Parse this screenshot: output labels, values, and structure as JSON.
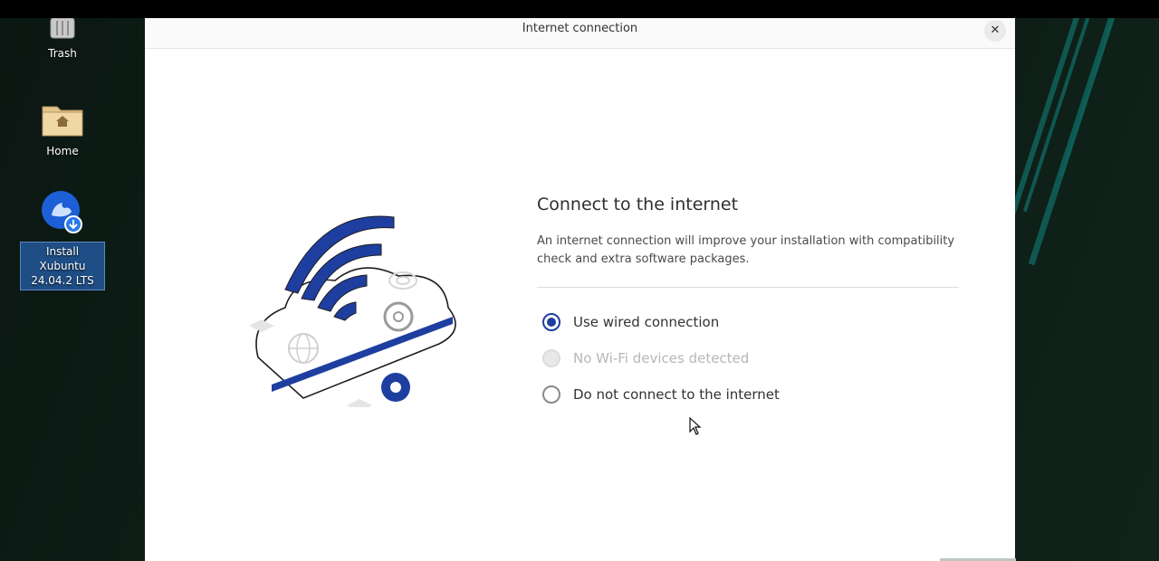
{
  "desktop": {
    "icons": [
      {
        "label": "Trash",
        "icon": "trash-icon"
      },
      {
        "label": "Home",
        "icon": "home-folder-icon"
      },
      {
        "label_line1": "Install Xubuntu",
        "label_line2": "24.04.2 LTS",
        "icon": "installer-icon",
        "selected": true
      }
    ],
    "accent_color": "#0f5e58"
  },
  "window": {
    "title": "Internet connection",
    "close_icon": "close-icon",
    "heading": "Connect to the internet",
    "description": "An internet connection will improve your installation with compatibility check and extra software packages.",
    "options": [
      {
        "label": "Use wired connection",
        "state": "checked"
      },
      {
        "label": "No Wi-Fi devices detected",
        "state": "disabled"
      },
      {
        "label": "Do not connect to the internet",
        "state": "unchecked"
      }
    ],
    "accent_color": "#1e3fa0"
  }
}
